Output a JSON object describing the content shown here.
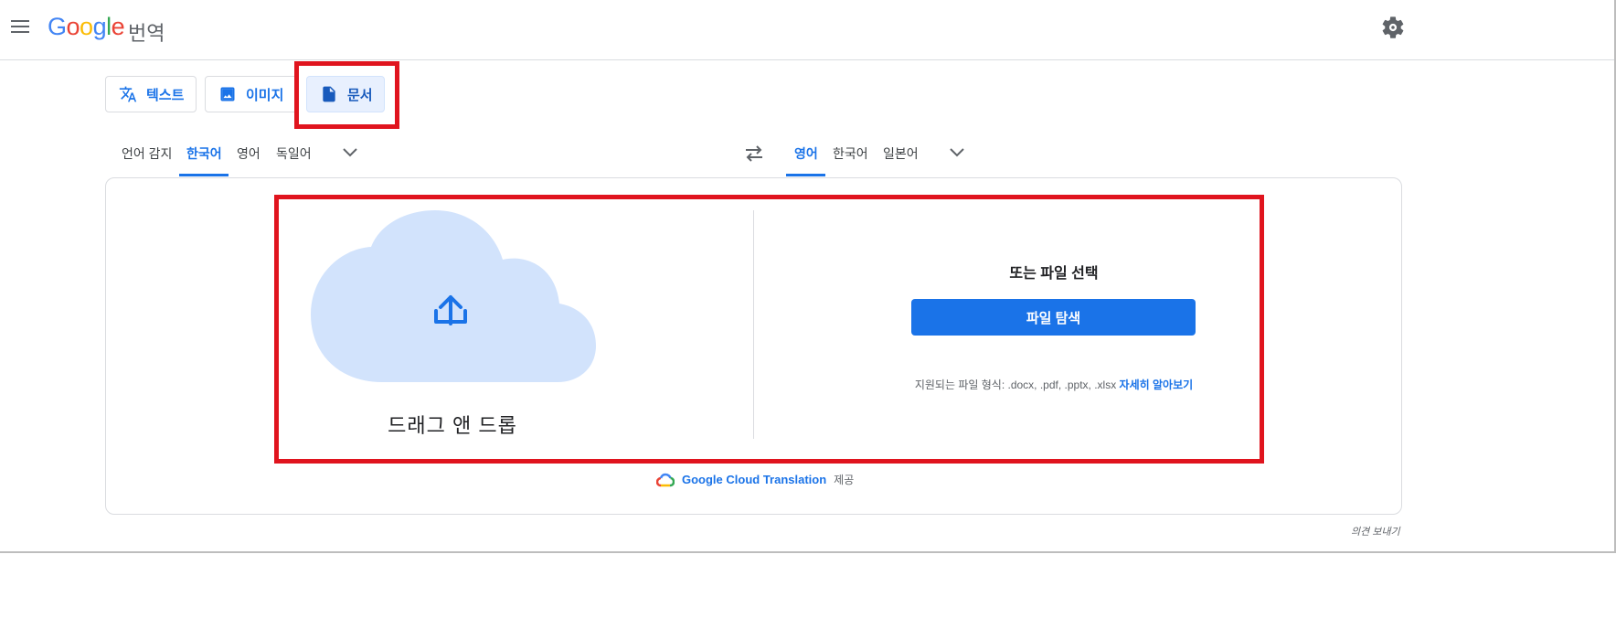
{
  "header": {
    "logo_letters": [
      "G",
      "o",
      "o",
      "g",
      "l",
      "e"
    ],
    "logo_suffix": "번역"
  },
  "mode_tabs": [
    {
      "label": "텍스트",
      "icon": "translate-icon",
      "active": false
    },
    {
      "label": "이미지",
      "icon": "image-icon",
      "active": false
    },
    {
      "label": "문서",
      "icon": "document-icon",
      "active": true
    }
  ],
  "source_langs": [
    "언어 감지",
    "한국어",
    "영어",
    "독일어"
  ],
  "source_active": "한국어",
  "target_langs": [
    "영어",
    "한국어",
    "일본어"
  ],
  "target_active": "영어",
  "upload": {
    "drag_text": "드래그 앤 드롭",
    "or_text": "또는 파일 선택",
    "browse_button": "파일 탐색",
    "formats_text": "지원되는 파일 형식: .docx, .pdf, .pptx, .xlsx",
    "learn_more": "자세히 알아보기"
  },
  "powered_by": {
    "brand": "Google Cloud Translation",
    "provided": "제공"
  },
  "feedback": "의견 보내기",
  "colors": {
    "accent": "#1a73e8",
    "highlight_box": "#e0141e",
    "cloud": "#d2e3fc"
  }
}
